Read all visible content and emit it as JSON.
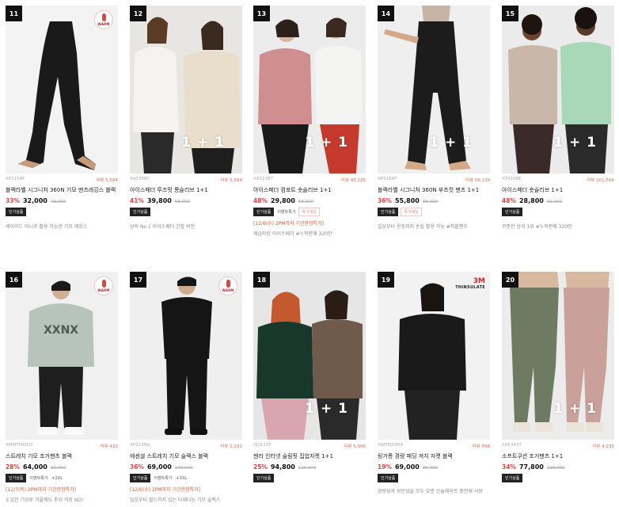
{
  "badge_warm": "WARM",
  "badge_oneplusone": "1 + 1",
  "badge_3m": {
    "line1": "3M",
    "line2": "THINSULATE"
  },
  "products": [
    {
      "rank": "11",
      "code": "XP2154F",
      "reviews": "리뷰 5,584",
      "title": "블랙라벨 시그니처 360N 기모 맨즈레깅스 블랙",
      "discount": "33%",
      "price": "32,000",
      "original": "48,000",
      "tags": [
        {
          "label": "인기상품",
          "style": "dark"
        }
      ],
      "promo": "",
      "desc": "레이어드 미니로 활용 가능한 기모 레깅스",
      "warm": true,
      "oneplus": false,
      "m3": false
    },
    {
      "rank": "12",
      "code": "XA5388C",
      "reviews": "리뷰 5,584",
      "title": "아이스페더 루즈핏 롱슬리브 1+1",
      "discount": "41%",
      "price": "39,800",
      "original": "68,000",
      "tags": [
        {
          "label": "인기상품",
          "style": "dark"
        }
      ],
      "promo": "",
      "desc": "상의 No.1 아이스페더 긴팔 버전",
      "warm": false,
      "oneplus": true,
      "m3": false
    },
    {
      "rank": "13",
      "code": "XA5238T",
      "reviews": "리뷰 45,225",
      "title": "아이스페더 컴포트 숏슬리브 1+1",
      "discount": "48%",
      "price": "29,800",
      "original": "58,000",
      "tags": [
        {
          "label": "인기상품",
          "style": "dark"
        },
        {
          "label": "이벤트특가",
          "style": "plain"
        },
        {
          "label": "특가세일",
          "style": "red"
        }
      ],
      "promo": "[12/6(수) 2PM까지 기간한정특가]",
      "desc": "제습마킹 아이스페더 #누적판매 320만",
      "warm": false,
      "oneplus": true,
      "m3": false
    },
    {
      "rank": "14",
      "code": "XP3166F",
      "reviews": "리뷰 16,139",
      "title": "블랙라벨 시그니처 360N 부츠컷 팬츠 1+1",
      "discount": "36%",
      "price": "55,800",
      "original": "88,000",
      "tags": [
        {
          "label": "인기상품",
          "style": "dark"
        },
        {
          "label": "특가세일",
          "style": "red"
        }
      ],
      "promo": "",
      "desc": "일상부터 운동까지 손쉽 활용 가능 #착붙팬츠",
      "warm": false,
      "oneplus": true,
      "m3": false
    },
    {
      "rank": "15",
      "code": "XT4108E",
      "reviews": "리뷰 101,504",
      "title": "아이스페더 숏슬리브 1+1",
      "discount": "48%",
      "price": "28,800",
      "original": "56,000",
      "tags": [
        {
          "label": "인기상품",
          "style": "dark"
        }
      ],
      "promo": "",
      "desc": "꾸준한 상의 1위 #누적판매 320만",
      "warm": false,
      "oneplus": true,
      "m3": false
    },
    {
      "rank": "16",
      "code": "XMMTP03H3",
      "reviews": "리뷰 433",
      "title": "스트레치 기모 조거팬츠 블랙",
      "discount": "28%",
      "price": "64,000",
      "original": "89,000",
      "tags": [
        {
          "label": "인기상품",
          "style": "dark"
        },
        {
          "label": "이벤트특가",
          "style": "plain"
        },
        {
          "label": "+2XL",
          "style": "plain"
        }
      ],
      "promo": "[12/7(목) 2PM까지 기간한정특가]",
      "desc": "도심한 기모로 겨울에도 추위 걱정 NO!",
      "warm": true,
      "oneplus": false,
      "m3": false
    },
    {
      "rank": "17",
      "code": "XP2136G",
      "reviews": "리뷰 2,331",
      "title": "에센셜 스트레치 기모 슬랙스 블랙",
      "discount": "36%",
      "price": "69,000",
      "original": "109,000",
      "tags": [
        {
          "label": "인기상품",
          "style": "dark"
        },
        {
          "label": "이벤트특가",
          "style": "plain"
        },
        {
          "label": "+3XL",
          "style": "plain"
        }
      ],
      "promo": "[12/6(수) 2PM까지 기간한정특가]",
      "desc": "일상부터 필드까지 입는 다재다능 기모 슬랙스",
      "warm": true,
      "oneplus": false,
      "m3": false
    },
    {
      "rank": "18",
      "code": "XJ0115F",
      "reviews": "리뷰 5,906",
      "title": "젠라 인터넷 슬림핏 집업자켓 1+1",
      "discount": "25%",
      "price": "94,800",
      "original": "126,000",
      "tags": [
        {
          "label": "인기상품",
          "style": "dark"
        }
      ],
      "promo": "",
      "desc": "",
      "warm": false,
      "oneplus": true,
      "m3": false
    },
    {
      "rank": "19",
      "code": "XWFEJ03H4",
      "reviews": "리뷰 598",
      "title": "링거롱 경량 패딩 져지 자켓 블랙",
      "discount": "19%",
      "price": "69,000",
      "original": "85,000",
      "tags": [
        {
          "label": "인기상품",
          "style": "dark"
        }
      ],
      "promo": "",
      "desc": "경량성과 보온성을 모두 갖춘 신슐레이트 충전재 사용",
      "warm": false,
      "oneplus": false,
      "m3": true
    },
    {
      "rank": "20",
      "code": "XA5343T",
      "reviews": "리뷰 4,235",
      "title": "소프트쿠션 조거팬츠 1+1",
      "discount": "34%",
      "price": "77,800",
      "original": "118,000",
      "tags": [
        {
          "label": "인기상품",
          "style": "dark"
        }
      ],
      "promo": "",
      "desc": "",
      "warm": false,
      "oneplus": true,
      "m3": false
    }
  ]
}
